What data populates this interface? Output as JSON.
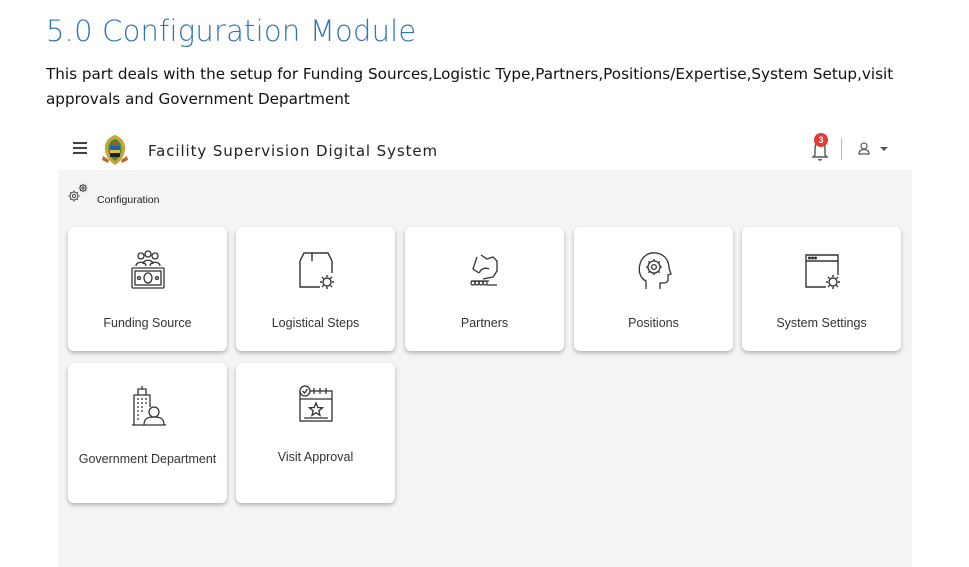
{
  "document": {
    "heading": "5.0 Configuration Module",
    "paragraph": "This part deals with the setup for Funding Sources,Logistic Type,Partners,Positions/Expertise,System Setup,visit approvals and Government Department"
  },
  "app": {
    "title": "Facility Supervision Digital System",
    "notifications_count": "3",
    "breadcrumb": "Configuration"
  },
  "cards": [
    {
      "label": "Funding Source",
      "icon": "funding-source-icon"
    },
    {
      "label": "Logistical Steps",
      "icon": "logistical-steps-icon"
    },
    {
      "label": "Partners",
      "icon": "handshake-icon"
    },
    {
      "label": "Positions",
      "icon": "head-gear-icon"
    },
    {
      "label": "System Settings",
      "icon": "window-gear-icon"
    },
    {
      "label": "Government Department",
      "icon": "government-building-icon"
    },
    {
      "label": "Visit Approval",
      "icon": "calendar-star-icon"
    }
  ],
  "colors": {
    "heading": "#2e75b6",
    "badge": "#e53935",
    "panel_bg": "#f4f4f4"
  }
}
